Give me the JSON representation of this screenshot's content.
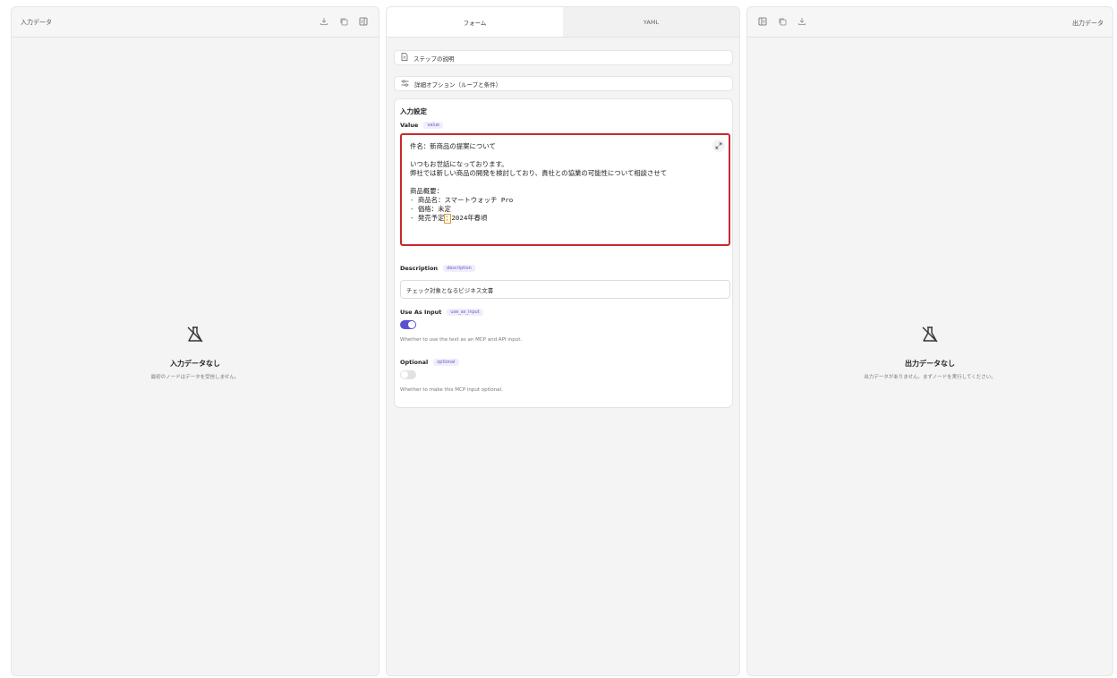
{
  "left": {
    "title": "入力データ",
    "empty_title": "入力データなし",
    "empty_sub": "最初のノードはデータを受信しません。"
  },
  "center": {
    "tabs": [
      {
        "label": "フォーム",
        "active": true
      },
      {
        "label": "YAML",
        "active": false
      }
    ],
    "step_desc": "ステップの説明",
    "advanced": "詳細オプション（ループと条件）",
    "section_title": "入力設定",
    "value": {
      "label": "Value",
      "key": "value",
      "lines": [
        "件名：新商品の提案について",
        "",
        "いつもお世話になっております。",
        "弊社では新しい商品の開発を検討しており、貴社との協業の可能性について相談させて",
        "",
        "商品概要：",
        "- 商品名：スマートウォッチ Pro",
        "- 価格：未定"
      ],
      "last_line_prefix": "- 発売予定",
      "last_line_mark": "：",
      "last_line_suffix": "2024年春頃"
    },
    "description": {
      "label": "Description",
      "key": "description",
      "value": "チェック対象となるビジネス文書"
    },
    "use_as_input": {
      "label": "Use As Input",
      "key": "use_as_input",
      "enabled": true,
      "help": "Whether to use the text as an MCP and API input."
    },
    "optional": {
      "label": "Optional",
      "key": "optional",
      "enabled": false,
      "help": "Whether to make this MCP input optional."
    }
  },
  "right": {
    "title": "出力データ",
    "empty_title": "出力データなし",
    "empty_sub": "出力データがありません。まずノードを実行してください。"
  },
  "colors": {
    "accent": "#5b4fd6",
    "highlight_border": "#c8282d",
    "panel_bg": "#f4f4f4"
  }
}
